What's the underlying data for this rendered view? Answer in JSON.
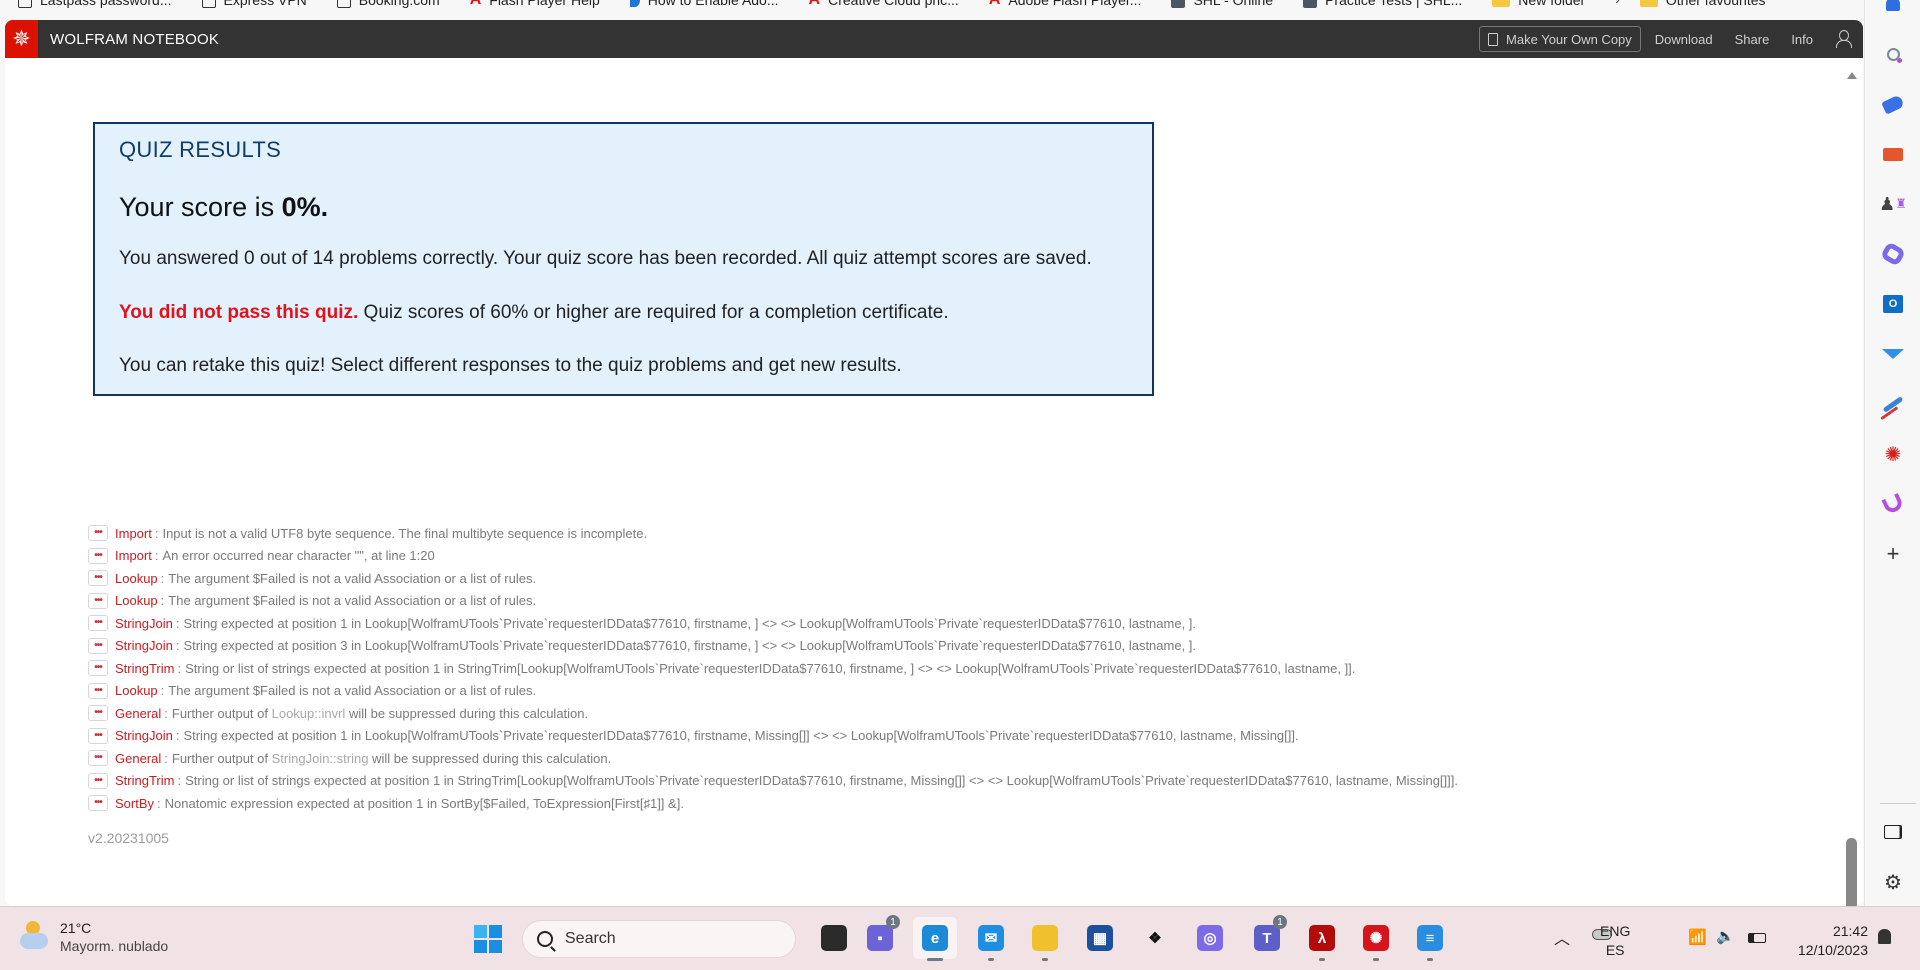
{
  "browser": {
    "bookmarks": [
      {
        "label": "Lastpass password...",
        "icon": "page-icon"
      },
      {
        "label": "Express VPN",
        "icon": "page-icon"
      },
      {
        "label": "Booking.com",
        "icon": "page-icon"
      },
      {
        "label": "Flash Player Help",
        "icon": "adobe-icon"
      },
      {
        "label": "How to Enable Ado...",
        "icon": "blue-page-icon"
      },
      {
        "label": "Creative Cloud pric...",
        "icon": "adobe-icon"
      },
      {
        "label": "Adobe Flash Player...",
        "icon": "adobe-icon"
      },
      {
        "label": "SHL - Online",
        "icon": "doc-icon"
      },
      {
        "label": "Practice Tests | SHL...",
        "icon": "doc-icon"
      },
      {
        "label": "New folder",
        "icon": "folder-icon"
      }
    ],
    "bookmarks_overflow": "›",
    "other_favourites": "Other favourites"
  },
  "app": {
    "title": "WOLFRAM NOTEBOOK",
    "actions": {
      "make_copy": "Make Your Own Copy",
      "download": "Download",
      "share": "Share",
      "info": "Info"
    }
  },
  "quiz": {
    "heading": "QUIZ RESULTS",
    "score_prefix": "Your score is ",
    "score_value": "0%.",
    "answered_text": "You answered 0 out of 14 problems correctly. Your quiz score has been recorded. All quiz attempt scores are saved.",
    "fail_label": "You did not pass this quiz.",
    "fail_text": " Quiz scores of 60% or higher are required for a completion certificate.",
    "retake_text": "You can retake this quiz! Select different responses to the quiz problems and get new results."
  },
  "messages": [
    {
      "name": "Import",
      "text": "Input is not a valid UTF8 byte sequence. The final multibyte sequence is incomplete."
    },
    {
      "name": "Import",
      "text": "An error occurred near character \"\", at line 1:20"
    },
    {
      "name": "Lookup",
      "text": "The argument $Failed is not a valid Association or a list of rules."
    },
    {
      "name": "Lookup",
      "text": "The argument $Failed is not a valid Association or a list of rules."
    },
    {
      "name": "StringJoin",
      "text": "String expected at position 1 in Lookup[WolframUTools`Private`requesterIDData$77610, firstname, ] <>  <> Lookup[WolframUTools`Private`requesterIDData$77610, lastname, ]."
    },
    {
      "name": "StringJoin",
      "text": "String expected at position 3 in Lookup[WolframUTools`Private`requesterIDData$77610, firstname, ] <>  <> Lookup[WolframUTools`Private`requesterIDData$77610, lastname, ]."
    },
    {
      "name": "StringTrim",
      "text": "String or list of strings expected at position 1 in StringTrim[Lookup[WolframUTools`Private`requesterIDData$77610, firstname, ] <>  <> Lookup[WolframUTools`Private`requesterIDData$77610, lastname, ]]."
    },
    {
      "name": "Lookup",
      "text": "The argument $Failed is not a valid Association or a list of rules."
    },
    {
      "name": "General",
      "text_before": "Further output of ",
      "symbol": "Lookup::invrl",
      "text_after": " will be suppressed during this calculation."
    },
    {
      "name": "StringJoin",
      "text": "String expected at position 1 in Lookup[WolframUTools`Private`requesterIDData$77610, firstname, Missing[]] <>  <> Lookup[WolframUTools`Private`requesterIDData$77610, lastname, Missing[]]."
    },
    {
      "name": "General",
      "text_before": "Further output of ",
      "symbol": "StringJoin::string",
      "text_after": " will be suppressed during this calculation."
    },
    {
      "name": "StringTrim",
      "text": "String or list of strings expected at position 1 in StringTrim[Lookup[WolframUTools`Private`requesterIDData$77610, firstname, Missing[]] <>  <> Lookup[WolframUTools`Private`requesterIDData$77610, lastname, Missing[]]]."
    },
    {
      "name": "SortBy",
      "text": "Nonatomic expression expected at position 1 in SortBy[$Failed, ToExpression[First[♯1]] &]."
    }
  ],
  "version": "v2.20231005",
  "edge_sidebar": [
    "bell-icon",
    "search-icon",
    "tag-icon",
    "toolbox-icon",
    "games-icon",
    "microsoft365-icon",
    "outlook-icon",
    "send-icon",
    "paint-icon",
    "wolfram-icon",
    "designer-icon",
    "add-icon",
    "split-screen-icon",
    "settings-icon"
  ],
  "taskbar": {
    "weather": {
      "temp": "21°C",
      "condition": "Mayorm. nublado"
    },
    "search_placeholder": "Search",
    "apps": [
      {
        "name": "task-view",
        "badge": ""
      },
      {
        "name": "teams-chat",
        "badge": "1"
      },
      {
        "name": "edge",
        "badge": ""
      },
      {
        "name": "mail",
        "badge": ""
      },
      {
        "name": "file-explorer",
        "badge": ""
      },
      {
        "name": "microsoft-store",
        "badge": ""
      },
      {
        "name": "dropbox",
        "badge": ""
      },
      {
        "name": "microsoft-365",
        "badge": ""
      },
      {
        "name": "teams",
        "badge": "1"
      },
      {
        "name": "acrobat",
        "badge": ""
      },
      {
        "name": "wolfram",
        "badge": ""
      },
      {
        "name": "notepad",
        "badge": ""
      }
    ],
    "language": {
      "line1": "ENG",
      "line2": "ES"
    },
    "time": "21:42",
    "date": "12/10/2023"
  }
}
